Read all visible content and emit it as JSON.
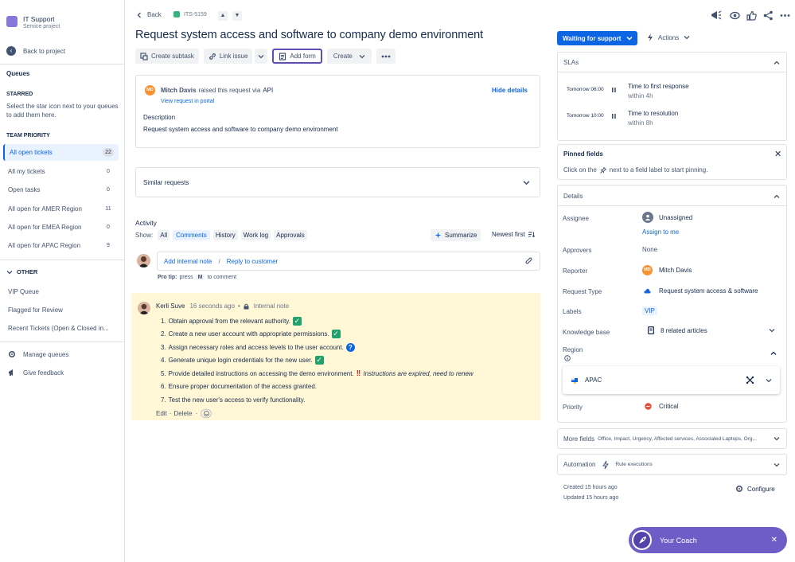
{
  "sidebar": {
    "project_name": "IT Support",
    "project_type": "Service project",
    "back_label": "Back to project",
    "queues_title": "Queues",
    "starred_title": "STARRED",
    "starred_hint": "Select the star icon next to your queues to add them here.",
    "team_priority_title": "TEAM PRIORITY",
    "team_items": [
      {
        "label": "All open tickets",
        "count": "22"
      },
      {
        "label": "All my tickets",
        "count": "0"
      },
      {
        "label": "Open tasks",
        "count": "0"
      },
      {
        "label": "All open for AMER Region",
        "count": "11"
      },
      {
        "label": "All open for EMEA Region",
        "count": "0"
      },
      {
        "label": "All open for APAC Region",
        "count": "9"
      }
    ],
    "other_title": "OTHER",
    "other_items": [
      "VIP Queue",
      "Flagged for Review",
      "Recent Tickets (Open & Closed in..."
    ],
    "manage_queues": "Manage queues",
    "give_feedback": "Give feedback"
  },
  "header": {
    "back": "Back",
    "issue_key": "ITS-5159",
    "title": "Request system access and software to company demo environment"
  },
  "toolbar": {
    "create_subtask": "Create subtask",
    "link_issue": "Link issue",
    "add_form": "Add form",
    "create": "Create"
  },
  "request": {
    "reporter": "Mitch Davis",
    "reporter_initials": "MD",
    "raised_text": "raised this request via",
    "channel": "API",
    "view_portal": "View request in portal",
    "hide_details": "Hide details",
    "description_label": "Description",
    "description": "Request system access and software to company demo environment"
  },
  "similar": {
    "label": "Similar requests"
  },
  "activity": {
    "title": "Activity",
    "show_label": "Show:",
    "filters": [
      "All",
      "Comments",
      "History",
      "Work log",
      "Approvals"
    ],
    "active_filter": "Comments",
    "summarize": "Summarize",
    "sort": "Newest first",
    "add_internal_note": "Add internal note",
    "separator": "/",
    "reply_to_customer": "Reply to customer",
    "pro_tip_label": "Pro tip:",
    "pro_tip_press": "press",
    "pro_tip_key": "M",
    "pro_tip_suffix": "to comment"
  },
  "comment": {
    "author": "Kerli Suve",
    "time": "16 seconds ago",
    "dot": "•",
    "visibility": "Internal note",
    "steps": [
      {
        "n": "1.",
        "text": "Obtain approval from the relevant authority.",
        "mark": "check"
      },
      {
        "n": "2.",
        "text": "Create a new user account with appropriate permissions.",
        "mark": "check"
      },
      {
        "n": "3.",
        "text": "Assign necessary roles and access levels to the user account.",
        "mark": "question"
      },
      {
        "n": "4.",
        "text": "Generate unique login credentials for the new user.",
        "mark": "check"
      },
      {
        "n": "5.",
        "text": "Provide detailed instructions on accessing the demo environment.",
        "mark": "alert",
        "note": "Instructions are expired, need to renew"
      },
      {
        "n": "6.",
        "text": "Ensure proper documentation of the access granted.",
        "mark": ""
      },
      {
        "n": "7.",
        "text": "Test the new user's access to verify functionality.",
        "mark": ""
      }
    ],
    "edit": "Edit",
    "delete": "Delete",
    "action_sep": "·"
  },
  "right": {
    "status": "Waiting for support",
    "actions": "Actions",
    "slas_title": "SLAs",
    "slas": [
      {
        "time": "Tomorrow 06:00",
        "name": "Time to first response",
        "within": "within 4h"
      },
      {
        "time": "Tomorrow 10:00",
        "name": "Time to resolution",
        "within": "within 8h"
      }
    ],
    "pinned_title": "Pinned fields",
    "pinned_hint_a": "Click on the",
    "pinned_hint_b": "next to a field label to start pinning.",
    "details_title": "Details",
    "assignee_label": "Assignee",
    "assignee_value": "Unassigned",
    "assign_to_me": "Assign to me",
    "approvers_label": "Approvers",
    "approvers_value": "None",
    "reporter_label": "Reporter",
    "reporter_value": "Mitch Davis",
    "reporter_initials": "MD",
    "request_type_label": "Request Type",
    "request_type_value": "Request system access & software",
    "labels_label": "Labels",
    "labels_value": "VIP",
    "kb_label": "Knowledge base",
    "kb_value": "8 related articles",
    "region_label": "Region",
    "region_value": "APAC",
    "priority_label": "Priority",
    "priority_value": "Critical",
    "more_fields_label": "More fields",
    "more_fields_value": "Office, Impact, Urgency, Affected services, Associated Laptops, Org...",
    "automation_label": "Automation",
    "automation_value": "Rule executions",
    "created": "Created 15 hours ago",
    "updated": "Updated 15 hours ago",
    "configure": "Configure"
  },
  "coach": {
    "label": "Your Coach"
  },
  "colors": {
    "primary": "#0c66e4",
    "comment_bg": "#fff7d6",
    "coach": "#6e5dc6",
    "check": "#22a06b",
    "alert": "#c9372c"
  }
}
